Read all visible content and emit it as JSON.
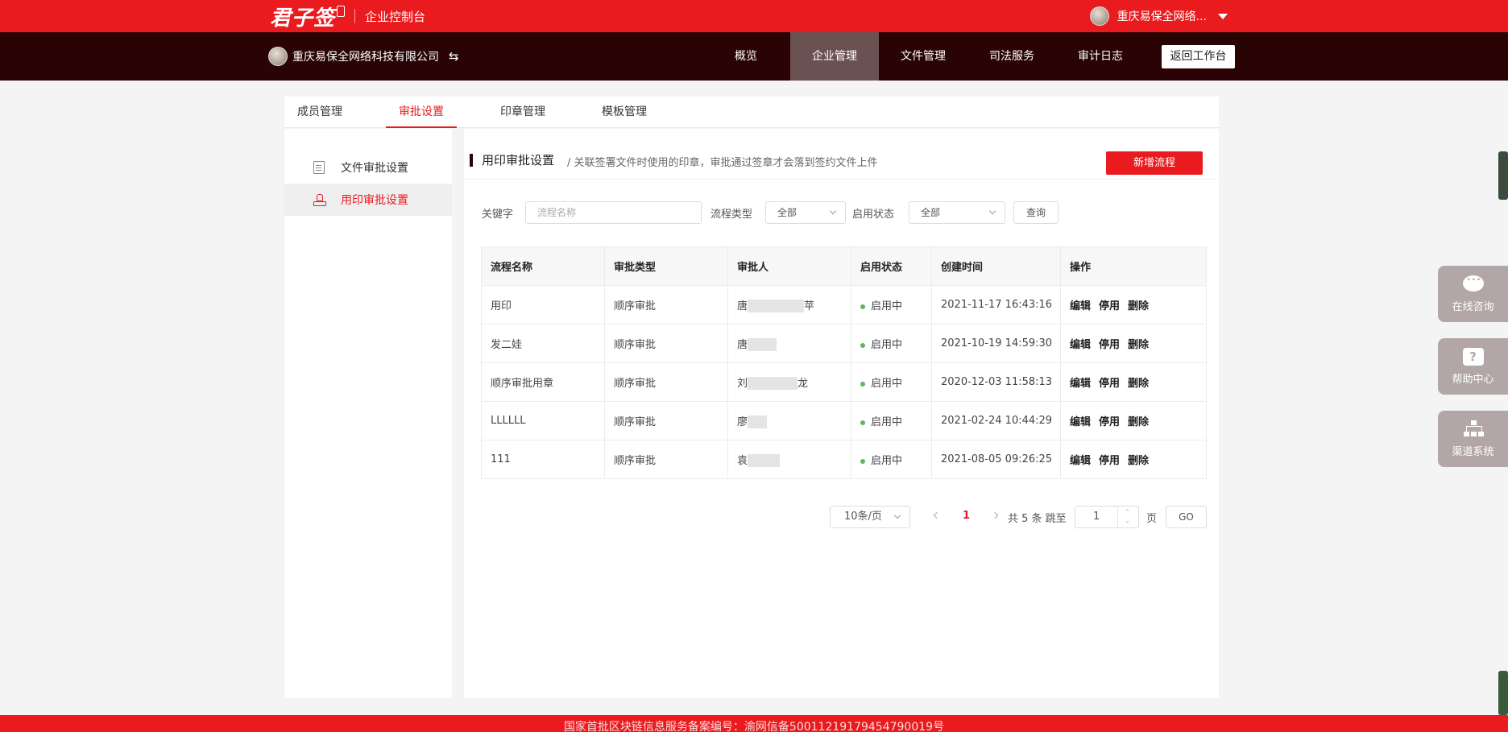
{
  "topbar": {
    "logo_text": "君子签",
    "subtitle": "企业控制台",
    "user_name": "重庆易保全网络..."
  },
  "navbar": {
    "org_name": "重庆易保全网络科技有限公司",
    "swap_glyph": "⇆",
    "items": [
      {
        "label": "概览"
      },
      {
        "label": "企业管理"
      },
      {
        "label": "文件管理"
      },
      {
        "label": "司法服务"
      },
      {
        "label": "审计日志"
      }
    ],
    "back_label": "返回工作台"
  },
  "tabs": [
    {
      "label": "成员管理"
    },
    {
      "label": "审批设置"
    },
    {
      "label": "印章管理"
    },
    {
      "label": "模板管理"
    }
  ],
  "sidebar": {
    "items": [
      {
        "label": "文件审批设置"
      },
      {
        "label": "用印审批设置"
      }
    ]
  },
  "section": {
    "title": "用印审批设置",
    "desc": "/ 关联签署文件时使用的印章，审批通过签章才会落到签约文件上件",
    "add_label": "新增流程"
  },
  "filters": {
    "keyword_label": "关键字",
    "keyword_placeholder": "流程名称",
    "type_label": "流程类型",
    "type_value": "全部",
    "status_label": "启用状态",
    "status_value": "全部",
    "query_label": "查询"
  },
  "table": {
    "headers": [
      "流程名称",
      "审批类型",
      "审批人",
      "启用状态",
      "创建时间",
      "操作"
    ],
    "rows": [
      {
        "name": "用印",
        "type": "顺序审批",
        "approver_pre": "唐",
        "approver_post": "苹",
        "status": "启用中",
        "created": "2021-11-17 16:43:16"
      },
      {
        "name": "发二娃",
        "type": "顺序审批",
        "approver_pre": "唐",
        "approver_post": "",
        "status": "启用中",
        "created": "2021-10-19 14:59:30"
      },
      {
        "name": "顺序审批用章",
        "type": "顺序审批",
        "approver_pre": "刘",
        "approver_post": "龙",
        "status": "启用中",
        "created": "2020-12-03 11:58:13"
      },
      {
        "name": "LLLLLL",
        "type": "顺序审批",
        "approver_pre": "廖",
        "approver_post": "",
        "status": "启用中",
        "created": "2021-02-24 10:44:29"
      },
      {
        "name": "111",
        "type": "顺序审批",
        "approver_pre": "袁",
        "approver_post": "",
        "status": "启用中",
        "created": "2021-08-05 09:26:25"
      }
    ],
    "ops": {
      "edit": "编辑",
      "disable": "停用",
      "delete": "删除"
    }
  },
  "pager": {
    "page_size": "10条/页",
    "current": "1",
    "total_text": "共 5 条 跳至",
    "jump_value": "1",
    "unit": "页",
    "go": "GO"
  },
  "floats": {
    "consult": "在线咨询",
    "help": "帮助中心",
    "channel": "渠道系统"
  },
  "footer": {
    "text": "国家首批区块链信息服务备案编号：渝网信备50011219179454790019号"
  }
}
